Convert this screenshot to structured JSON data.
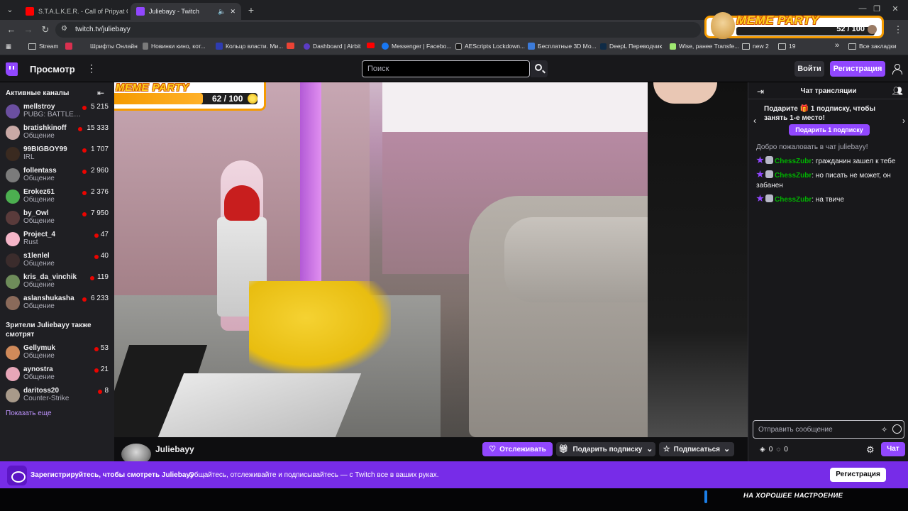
{
  "browser": {
    "tabs": [
      {
        "title": "S.T.A.L.K.E.R. - Call of Pripyat O...",
        "active": false
      },
      {
        "title": "Juliebayy - Twitch",
        "active": true
      }
    ],
    "new_tab": "+",
    "url": "twitch.tv/juliebayy",
    "bookmarks": [
      "Stream",
      "Шрифты Онлайн",
      "Новинки кино, кот...",
      "Кольцо власти. Ми...",
      "Dashboard | Airbit",
      "Messenger | Facebo...",
      "AEScripts Lockdown...",
      "Бесплатные 3D Мо...",
      "DeepL Переводчик",
      "Wise, ранее Transfe...",
      "new 2",
      "19"
    ],
    "all_bookmarks": "Все закладки",
    "more": "»"
  },
  "meme_widget_top": {
    "title": "MEME PARTY",
    "count": "52 / 100"
  },
  "meme_widget_video": {
    "title": "MEME PARTY",
    "count": "62 / 100",
    "progress": 0.62
  },
  "topnav": {
    "browse": "Просмотр",
    "search_placeholder": "Поиск",
    "login": "Войти",
    "signup": "Регистрация"
  },
  "sidebar": {
    "active_title": "Активные каналы",
    "active_channels": [
      {
        "name": "mellstroy",
        "category": "PUBG: BATTLEG...",
        "viewers": "5 215",
        "color": "#6b4fa0"
      },
      {
        "name": "bratishkinoff",
        "category": "Общение",
        "viewers": "15 333",
        "color": "#c9a9a6"
      },
      {
        "name": "99BIGBOY99",
        "category": "IRL",
        "viewers": "1 707",
        "color": "#3a2a20"
      },
      {
        "name": "follentass",
        "category": "Общение",
        "viewers": "2 960",
        "color": "#7b7b7b"
      },
      {
        "name": "Erokez61",
        "category": "Общение",
        "viewers": "2 376",
        "color": "#4caf50"
      },
      {
        "name": "by_Owl",
        "category": "Общение",
        "viewers": "7 950",
        "color": "#5a3b3b"
      },
      {
        "name": "Project_4",
        "category": "Rust",
        "viewers": "47",
        "color": "#f5b5c8"
      },
      {
        "name": "s1lenlel",
        "category": "Общение",
        "viewers": "40",
        "color": "#3b2c2c"
      },
      {
        "name": "kris_da_vinchik",
        "category": "Общение",
        "viewers": "119",
        "color": "#6e8c5a"
      },
      {
        "name": "aslanshukasha",
        "category": "Общение",
        "viewers": "6 233",
        "color": "#8a6a5a"
      }
    ],
    "also_watch_title": "Зрители Juliebayy также смотрят",
    "also_watch": [
      {
        "name": "Gellymuk",
        "category": "Общение",
        "viewers": "53",
        "color": "#d08a5a"
      },
      {
        "name": "aynostra",
        "category": "Общение",
        "viewers": "21",
        "color": "#e7a6b8"
      },
      {
        "name": "daritoss20",
        "category": "Counter-Strike",
        "viewers": "8",
        "color": "#a89a8a"
      }
    ],
    "show_more": "Показать еще"
  },
  "stream": {
    "streamer": "Juliebayy",
    "follow": "Отслеживать",
    "gift_sub": "Подарить подписку",
    "subscribe": "Подписаться"
  },
  "chat": {
    "title": "Чат трансляции",
    "gift_promo": "Подарите 🎁 1 подписку, чтобы занять 1-е место!",
    "gift_one": "Подарить 1 подписку",
    "welcome": "Добро пожаловать в чат juliebayy!",
    "messages": [
      {
        "user": "ChessZubr",
        "text": ": гражданин зашел к тебе"
      },
      {
        "user": "ChessZubr",
        "text": ": но писать не может, он забанен"
      },
      {
        "user": "ChessZubr",
        "text": ": на твиче"
      }
    ],
    "input_placeholder": "Отправить сообщение",
    "points_a": "0",
    "points_b": "0",
    "send": "Чат"
  },
  "banner": {
    "title": "Зарегистрируйтесь, чтобы смотреть Juliebayy",
    "text": "Общайтесь, отслеживайте и подписывайтесь — с Twitch все в ваших руках.",
    "button": "Регистрация"
  },
  "overlay": {
    "mood": "НА ХОРОШЕЕ НАСТРОЕНИЕ"
  }
}
